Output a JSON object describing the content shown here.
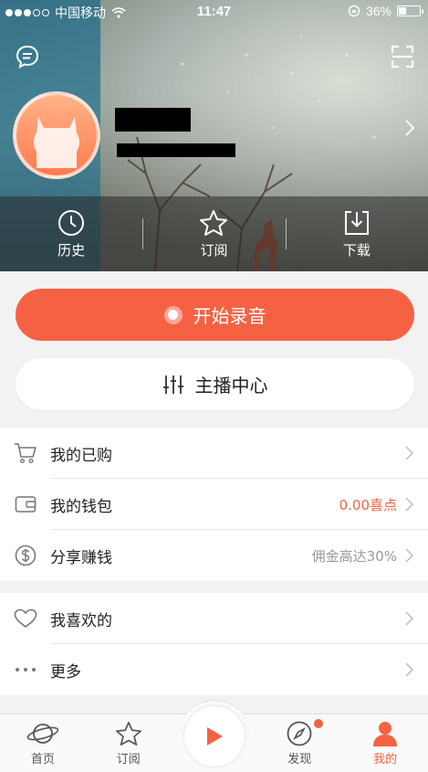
{
  "status_bar": {
    "carrier": "中国移动",
    "time": "11:47",
    "battery": "36%",
    "battery_level": 0.36
  },
  "header": {
    "quick_actions": [
      {
        "label": "历史",
        "icon": "clock-icon"
      },
      {
        "label": "订阅",
        "icon": "star-icon"
      },
      {
        "label": "下载",
        "icon": "download-icon"
      }
    ]
  },
  "buttons": {
    "record_label": "开始录音",
    "anchor_label": "主播中心"
  },
  "menu_group1": [
    {
      "label": "我的已购",
      "extra": "",
      "icon": "cart-icon"
    },
    {
      "label": "我的钱包",
      "extra": "0.00喜点",
      "icon": "wallet-icon"
    },
    {
      "label": "分享赚钱",
      "extra": "佣金高达30%",
      "icon": "dollar-icon"
    }
  ],
  "menu_group2": [
    {
      "label": "我喜欢的",
      "extra": "",
      "icon": "heart-icon"
    },
    {
      "label": "更多",
      "extra": "",
      "icon": "more-dots-icon"
    }
  ],
  "tabbar": [
    {
      "label": "首页",
      "icon": "planet-icon"
    },
    {
      "label": "订阅",
      "icon": "star-icon"
    },
    {
      "label": "发现",
      "icon": "compass-icon"
    },
    {
      "label": "我的",
      "icon": "person-icon"
    }
  ],
  "colors": {
    "accent": "#f56243"
  }
}
